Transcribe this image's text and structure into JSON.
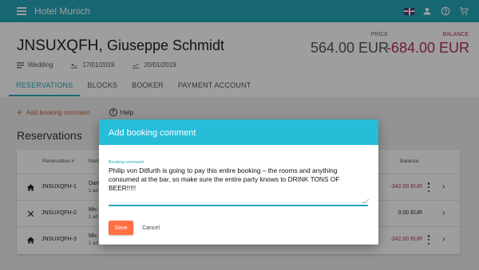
{
  "app": {
    "title": "Hotel Munich"
  },
  "booking": {
    "id": "JNSUXQFH,",
    "guest": "Giuseppe Schmidt",
    "type": "Wedding",
    "arrival": "17/01/2019",
    "departure": "20/01/2019",
    "price_label": "PRICE",
    "price": "564.00 EUR",
    "balance_label": "BALANCE",
    "balance": "-684.00 EUR"
  },
  "tabs": [
    "RESERVATIONS",
    "BLOCKS",
    "BOOKER",
    "PAYMENT ACCOUNT"
  ],
  "actions": {
    "add_comment": "Add booking comment",
    "help": "Help"
  },
  "reservations": {
    "heading": "Reservations",
    "columns": {
      "reservation": "Reservation #",
      "name": "Nam",
      "balance": "Balance"
    },
    "rows": [
      {
        "icon": "home-icon",
        "number": "JNSUXQFH-1",
        "name": "Dari",
        "sub": "1 ad",
        "balance": "-342.00 EUR",
        "negative": true
      },
      {
        "icon": "close-icon",
        "number": "JNSUXQFH-2",
        "name": "Mic",
        "sub": "1 ad",
        "balance": "0.00 EUR",
        "negative": false
      },
      {
        "icon": "home-icon",
        "number": "JNSUXQFH-3",
        "name": "Mic",
        "sub": "1 ad",
        "balance": "-342.00 EUR",
        "negative": true
      }
    ]
  },
  "dialog": {
    "title": "Add booking comment",
    "field_label": "Booking comment",
    "field_value": "Philip von Ditfurth is going to pay this entire booking – the rooms and anything consumed at the bar, so make sure the entire party knows to DRINK TONS OF BEER!!!!!",
    "save": "Save",
    "cancel": "Cancel"
  },
  "colors": {
    "primary": "#26a6b8",
    "dialog_header": "#26bdd8",
    "accent": "#ff7043",
    "negative": "#b0305c"
  }
}
